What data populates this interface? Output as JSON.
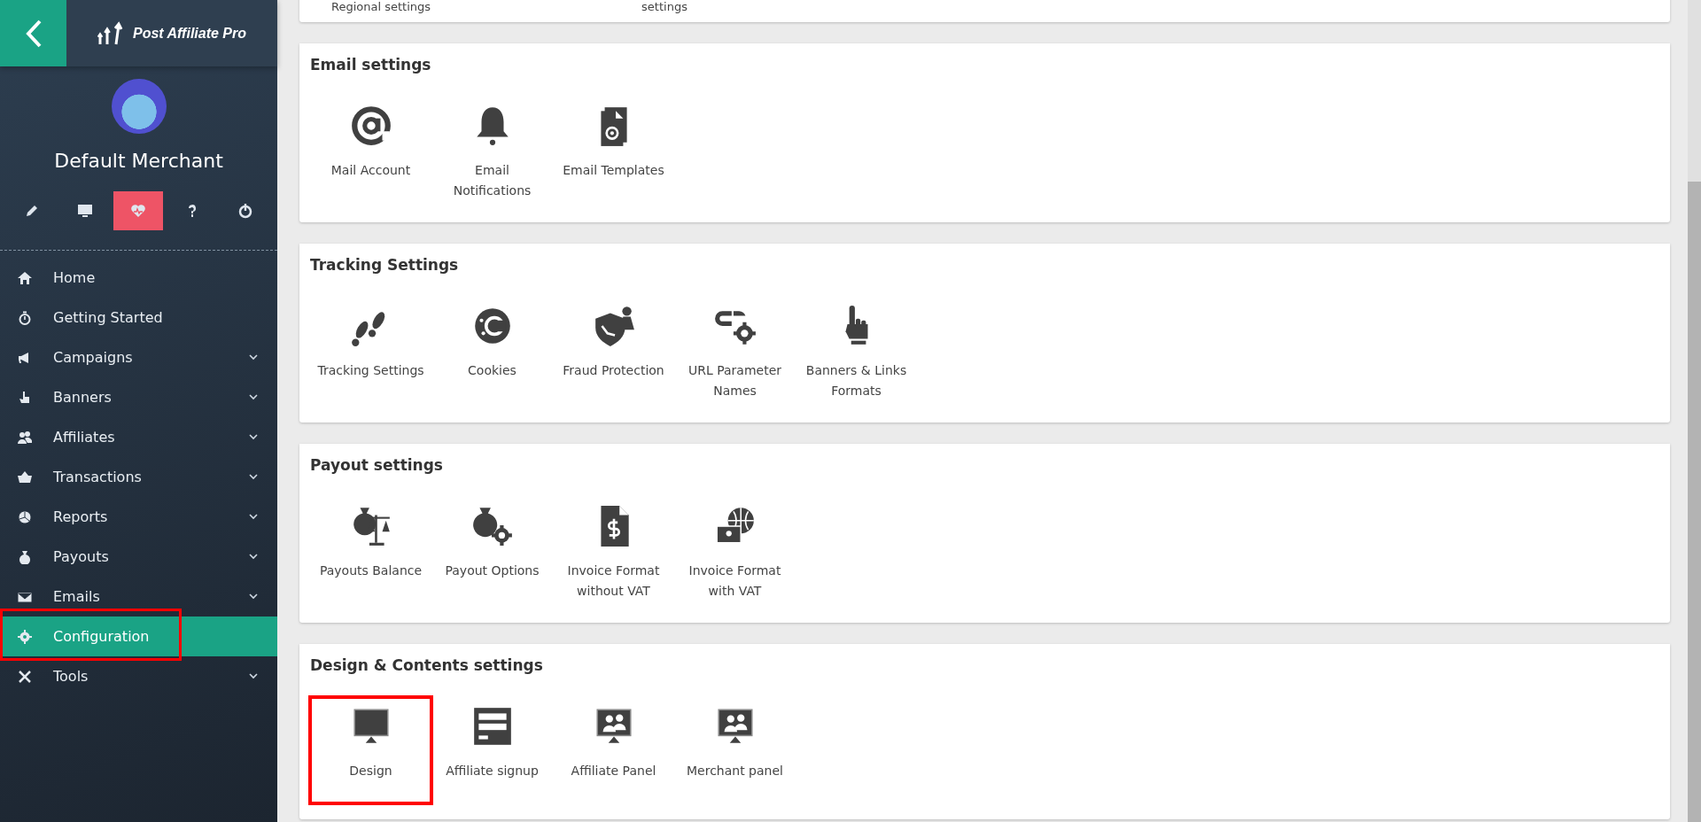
{
  "header": {
    "logo_text": "Post Affiliate Pro"
  },
  "profile": {
    "name": "Default Merchant"
  },
  "toolbar": [
    {
      "selected": false
    },
    {
      "selected": false
    },
    {
      "selected": true
    },
    {
      "selected": false
    },
    {
      "selected": false
    }
  ],
  "menu": [
    {
      "label": "Home",
      "kind": "link",
      "selected": false,
      "highlighted": false
    },
    {
      "label": "Getting Started",
      "kind": "link",
      "selected": false,
      "highlighted": false
    },
    {
      "label": "Campaigns",
      "kind": "submenu",
      "selected": false,
      "highlighted": false
    },
    {
      "label": "Banners",
      "kind": "submenu",
      "selected": false,
      "highlighted": false
    },
    {
      "label": "Affiliates",
      "kind": "submenu",
      "selected": false,
      "highlighted": false
    },
    {
      "label": "Transactions",
      "kind": "submenu",
      "selected": false,
      "highlighted": false
    },
    {
      "label": "Reports",
      "kind": "submenu",
      "selected": false,
      "highlighted": false
    },
    {
      "label": "Payouts",
      "kind": "submenu",
      "selected": false,
      "highlighted": false
    },
    {
      "label": "Emails",
      "kind": "submenu",
      "selected": false,
      "highlighted": false
    },
    {
      "label": "Configuration",
      "kind": "link",
      "selected": true,
      "highlighted": true
    },
    {
      "label": "Tools",
      "kind": "submenu",
      "selected": false,
      "highlighted": false
    }
  ],
  "sections": [
    {
      "items": [
        {
          "label": "Regional settings",
          "highlighted": false
        },
        {
          "label": "settings",
          "highlighted": false
        }
      ]
    },
    {
      "title": "Email settings",
      "items": [
        {
          "label": "Mail Account",
          "highlighted": false
        },
        {
          "label": "Email Notifications",
          "highlighted": false
        },
        {
          "label": "Email Templates",
          "highlighted": false
        }
      ]
    },
    {
      "title": "Tracking Settings",
      "items": [
        {
          "label": "Tracking Settings",
          "highlighted": false
        },
        {
          "label": "Cookies",
          "highlighted": false
        },
        {
          "label": "Fraud Protection",
          "highlighted": false
        },
        {
          "label": "URL Parameter Names",
          "highlighted": false
        },
        {
          "label": "Banners & Links Formats",
          "highlighted": false
        }
      ]
    },
    {
      "title": "Payout settings",
      "items": [
        {
          "label": "Payouts Balance",
          "highlighted": false
        },
        {
          "label": "Payout Options",
          "highlighted": false
        },
        {
          "label": "Invoice Format without VAT",
          "highlighted": false
        },
        {
          "label": "Invoice Format with VAT",
          "highlighted": false
        }
      ]
    },
    {
      "title": "Design & Contents settings",
      "items": [
        {
          "label": "Design",
          "highlighted": true
        },
        {
          "label": "Affiliate signup",
          "highlighted": false
        },
        {
          "label": "Affiliate Panel",
          "highlighted": false
        },
        {
          "label": "Merchant panel",
          "highlighted": false
        }
      ]
    }
  ]
}
